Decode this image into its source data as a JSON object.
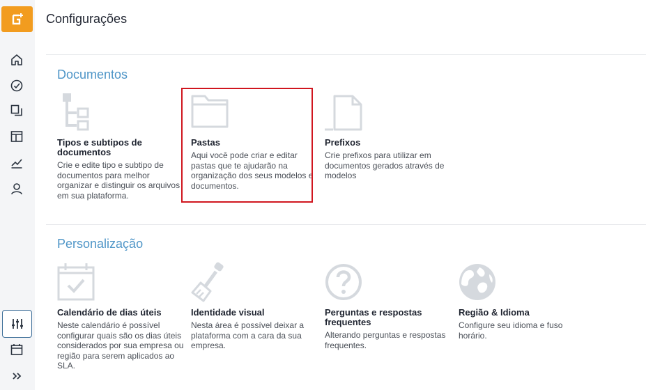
{
  "header": {
    "title": "Configurações"
  },
  "sections": {
    "documentos": {
      "title": "Documentos",
      "cards": [
        {
          "title": "Tipos e subtipos de documentos",
          "desc": "Crie e edite tipo e subtipo de documentos para melhor organizar e distinguir os arquivos em sua plataforma."
        },
        {
          "title": "Pastas",
          "desc": "Aqui você pode criar e editar pastas que te ajudarão na organização dos seus modelos e documentos."
        },
        {
          "title": "Prefixos",
          "desc": "Crie prefixos para utilizar em documentos gerados através de modelos"
        }
      ]
    },
    "personalizacao": {
      "title": "Personalização",
      "cards": [
        {
          "title": "Calendário de dias úteis",
          "desc": "Neste calendário é possível configurar quais são os dias úteis considerados por sua empresa ou região para serem aplicados ao SLA."
        },
        {
          "title": "Identidade visual",
          "desc": "Nesta área é possível deixar a plataforma com a cara da sua empresa."
        },
        {
          "title": "Perguntas e respostas frequentes",
          "desc": "Alterando perguntas e respostas frequentes."
        },
        {
          "title": "Região & Idioma",
          "desc": "Configure seu idioma e fuso horário."
        }
      ]
    }
  },
  "colors": {
    "accent": "#f29c1f",
    "section_title": "#4e95c7",
    "highlight": "#d0161f",
    "icon_gray": "#d5d9de"
  },
  "icons": [
    "logo-icon",
    "home-icon",
    "dashboard-icon",
    "documents-icon",
    "layout-icon",
    "chart-icon",
    "user-icon",
    "settings-sliders-icon",
    "calendar-icon",
    "expand-icon"
  ]
}
